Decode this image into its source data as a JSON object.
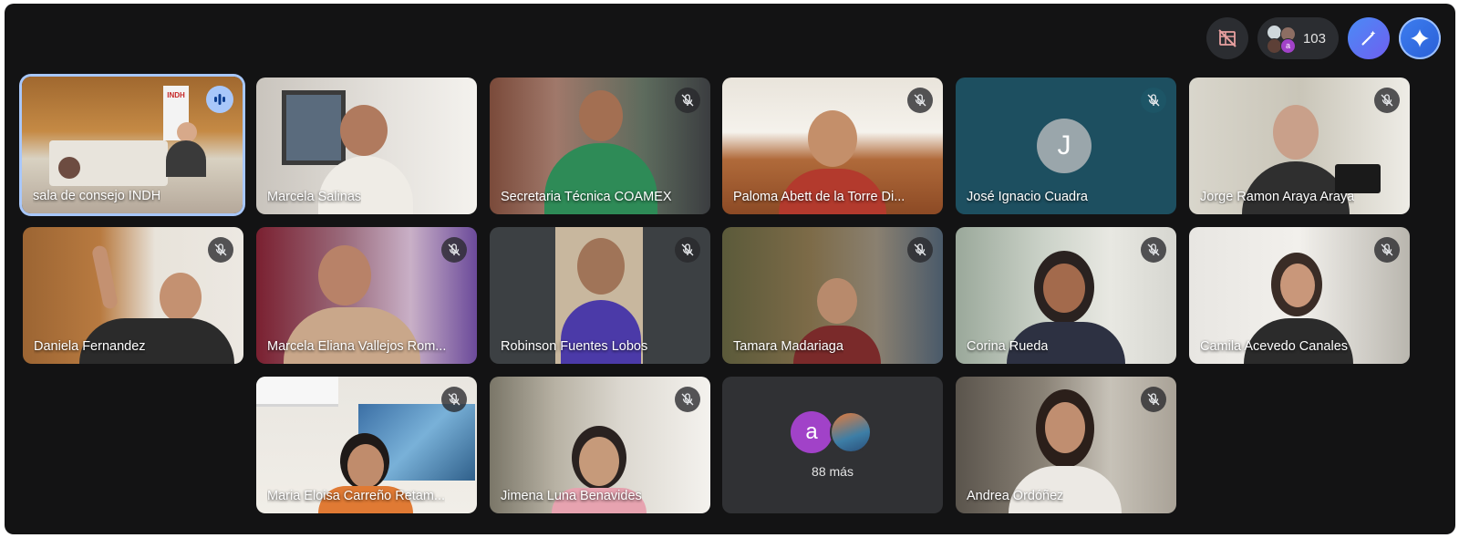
{
  "toolbar": {
    "participant_count": "103",
    "icons": [
      "layout-off-icon",
      "people-icon",
      "magic-pen-icon",
      "gemini-sparkle-icon"
    ]
  },
  "tiles": [
    {
      "name": "sala de consejo INDH",
      "speaking": true,
      "muted": false,
      "logo_text": "INDH"
    },
    {
      "name": "Marcela Salinas",
      "muted": false
    },
    {
      "name": "Secretaria Técnica COAMEX",
      "muted": true
    },
    {
      "name": "Paloma Abett de la Torre Di...",
      "muted": true
    },
    {
      "name": "José Ignacio Cuadra",
      "muted": true,
      "avatar_letter": "J"
    },
    {
      "name": "Jorge Ramon Araya Araya",
      "muted": true
    },
    {
      "name": "Daniela Fernandez",
      "muted": true
    },
    {
      "name": "Marcela Eliana Vallejos Rom...",
      "muted": true
    },
    {
      "name": "Robinson Fuentes Lobos",
      "muted": true
    },
    {
      "name": "Tamara Madariaga",
      "muted": true
    },
    {
      "name": "Corina Rueda",
      "muted": true
    },
    {
      "name": "Camila Acevedo Canales",
      "muted": true
    },
    {
      "name": "Maria Eloisa Carreño Retam...",
      "muted": true
    },
    {
      "name": "Jimena Luna Benavides",
      "muted": true
    },
    {
      "name": "88 más",
      "avatar_letter": "a"
    },
    {
      "name": "Andrea Ordóñez",
      "muted": true
    }
  ]
}
